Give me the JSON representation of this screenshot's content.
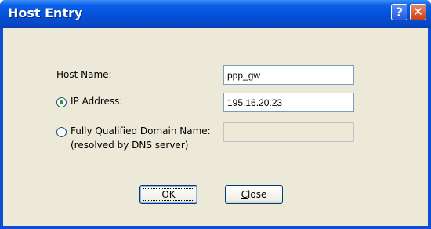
{
  "window": {
    "title": "Host Entry",
    "help_glyph": "?",
    "close_glyph": "✕"
  },
  "form": {
    "host_name_label": "Host Name:",
    "host_name_value": "ppp_gw",
    "ip_address_label": "IP Address:",
    "ip_address_value": "195.16.20.23",
    "ip_address_selected": true,
    "fqdn_label": "Fully Qualified Domain Name:",
    "fqdn_sublabel": "(resolved by DNS server)",
    "fqdn_value": "",
    "fqdn_selected": false
  },
  "buttons": {
    "ok_label": "OK",
    "close_label_mnemonic": "C",
    "close_label_rest": "lose"
  },
  "colors": {
    "title_bar": "#0450d8",
    "dialog_face": "#ece9d8",
    "radio_dot": "#21a121"
  }
}
